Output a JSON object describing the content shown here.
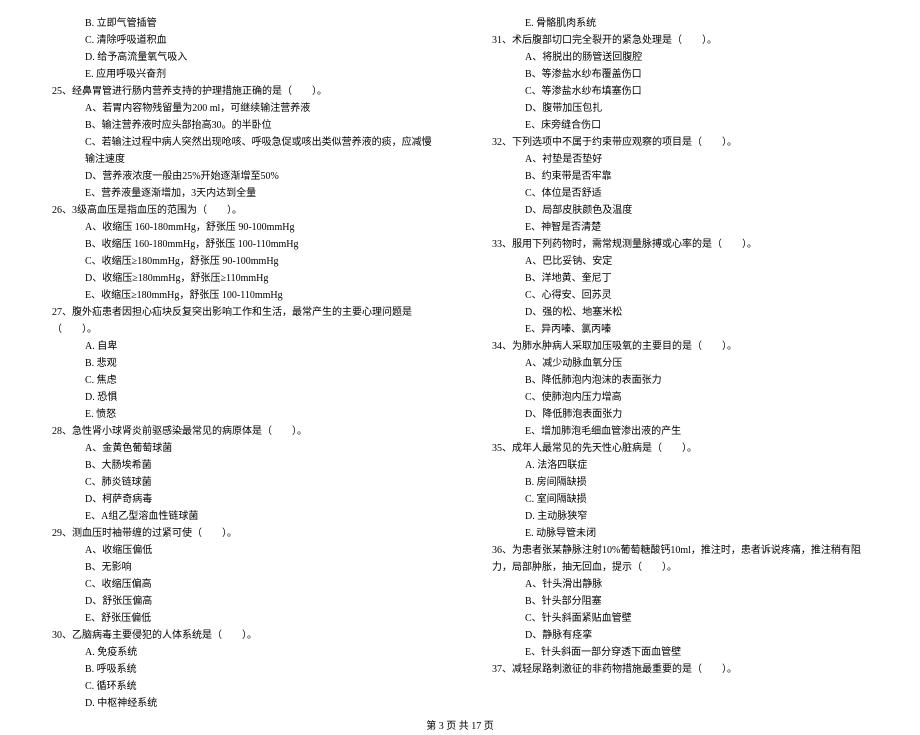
{
  "left": {
    "opts24": [
      "B. 立即气管插管",
      "C. 清除呼吸道积血",
      "D. 给予高流量氧气吸入",
      "E. 应用呼吸兴奋剂"
    ],
    "q25": "25、经鼻胃管进行肠内营养支持的护理措施正确的是（　　）。",
    "opts25": [
      "A、若胃内容物残留量为200 ml，可继续输注营养液",
      "B、输注营养液时应头部抬高30。的半卧位",
      "C、若输注过程中病人突然出现呛咳、呼吸急促或咳出类似营养液的痰，应减慢输注速度",
      "D、营养液浓度一般由25%开始逐渐增至50%",
      "E、营养液量逐渐增加，3天内达到全量"
    ],
    "q26": "26、3级高血压是指血压的范围为（　　）。",
    "opts26": [
      "A、收缩压 160-180mmHg，舒张压 90-100mmHg",
      "B、收缩压 160-180mmHg，舒张压 100-110mmHg",
      "C、收缩压≥180mmHg，舒张压 90-100mmHg",
      "D、收缩压≥180mmHg，舒张压≥110mmHg",
      "E、收缩压≥180mmHg，舒张压 100-110mmHg"
    ],
    "q27": "27、腹外疝患者因担心疝块反复突出影响工作和生活，最常产生的主要心理问题是（　　）。",
    "opts27": [
      "A. 自卑",
      "B. 悲观",
      "C. 焦虑",
      "D. 恐惧",
      "E. 愤怒"
    ],
    "q28": "28、急性肾小球肾炎前驱感染最常见的病原体是（　　）。",
    "opts28": [
      "A、金黄色葡萄球菌",
      "B、大肠埃希菌",
      "C、肺炎链球菌",
      "D、柯萨奇病毒",
      "E、A组乙型溶血性链球菌"
    ],
    "q29": "29、测血压时袖带缠的过紧可使（　　）。",
    "opts29": [
      "A、收缩压偏低",
      "B、无影响",
      "C、收缩压偏高",
      "D、舒张压偏高",
      "E、舒张压偏低"
    ],
    "q30": "30、乙脑病毒主要侵犯的人体系统是（　　）。",
    "opts30": [
      "A. 免疫系统",
      "B. 呼吸系统",
      "C. 循环系统",
      "D. 中枢神经系统"
    ]
  },
  "right": {
    "opt30e": "E. 骨骼肌肉系统",
    "q31": "31、术后腹部切口完全裂开的紧急处理是（　　）。",
    "opts31": [
      "A、将脱出的肠管送回腹腔",
      "B、等渗盐水纱布覆盖伤口",
      "C、等渗盐水纱布填塞伤口",
      "D、腹带加压包扎",
      "E、床旁缝合伤口"
    ],
    "q32": "32、下列选项中不属于约束带应观察的项目是（　　）。",
    "opts32": [
      "A、衬垫是否垫好",
      "B、约束带是否牢靠",
      "C、体位是否舒适",
      "D、局部皮肤颜色及温度",
      "E、神智是否清楚"
    ],
    "q33": "33、服用下列药物时，需常规测量脉搏或心率的是（　　）。",
    "opts33": [
      "A、巴比妥钠、安定",
      "B、洋地黄、奎尼丁",
      "C、心得安、回苏灵",
      "D、强的松、地塞米松",
      "E、异丙嗪、氯丙嗪"
    ],
    "q34": "34、为肺水肿病人采取加压吸氧的主要目的是（　　）。",
    "opts34": [
      "A、减少动脉血氧分压",
      "B、降低肺泡内泡沫的表面张力",
      "C、使肺泡内压力增高",
      "D、降低肺泡表面张力",
      "E、增加肺泡毛细血管渗出液的产生"
    ],
    "q35": "35、成年人最常见的先天性心脏病是（　　）。",
    "opts35": [
      "A. 法洛四联症",
      "B. 房间隔缺损",
      "C. 室间隔缺损",
      "D. 主动脉狭窄",
      "E. 动脉导管未闭"
    ],
    "q36": "36、为患者张某静脉注射10%葡萄糖酸钙10ml，推注时，患者诉说疼痛，推注稍有阻力，局部肿胀，抽无回血，提示（　　）。",
    "opts36": [
      "A、针头滑出静脉",
      "B、针头部分阻塞",
      "C、针头斜面紧贴血管壁",
      "D、静脉有痉挛",
      "E、针头斜面一部分穿透下面血管壁"
    ],
    "q37": "37、减轻尿路刺激征的非药物措施最重要的是（　　）。"
  },
  "footer": "第 3 页 共 17 页"
}
